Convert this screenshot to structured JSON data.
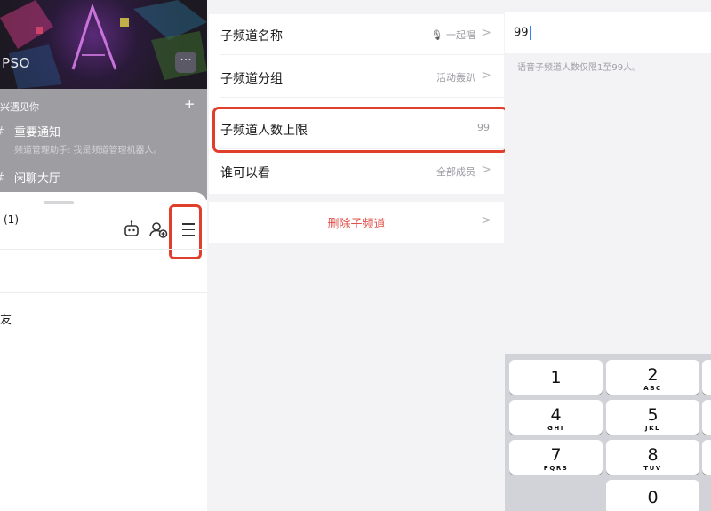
{
  "panel1": {
    "banner": {
      "brand_text": "PSO",
      "more_icon": "more-dots-icon"
    },
    "group": {
      "title": "兴遇见你",
      "add_icon": "+",
      "channels": [
        {
          "name": "重要通知",
          "sub": "频道管理助手: 我是频道管理机器人。",
          "icon": "announcement-icon"
        },
        {
          "name": "闲聊大厅",
          "sub": "",
          "icon": "chat-icon"
        }
      ]
    },
    "sheet": {
      "title": "(1)",
      "robot_icon": "robot-icon",
      "add_member_icon": "add-member-icon",
      "menu_icon": "menu-icon",
      "friend_text": "友"
    }
  },
  "panel2": {
    "rows": [
      {
        "label": "子频道名称",
        "value": "一起唱",
        "value_icon": "microphone-icon"
      },
      {
        "label": "子频道分组",
        "value": "活动轰趴"
      },
      {
        "label": "子频道人数上限",
        "value": "99"
      },
      {
        "label": "谁可以看",
        "value": "全部成员"
      }
    ],
    "delete_label": "删除子频道",
    "chevron": ">"
  },
  "panel3": {
    "input_value": "99",
    "hint": "语音子频道人数仅限1至99人。",
    "keys": [
      {
        "num": "1",
        "letters": ""
      },
      {
        "num": "2",
        "letters": "ABC"
      },
      {
        "num": "4",
        "letters": "GHI"
      },
      {
        "num": "5",
        "letters": "JKL"
      },
      {
        "num": "7",
        "letters": "PQRS"
      },
      {
        "num": "8",
        "letters": "TUV"
      },
      {
        "num": "0",
        "letters": ""
      }
    ]
  },
  "colors": {
    "highlight": "#e03f2b",
    "danger_text": "#e0524a",
    "caret": "#3a7bf7",
    "secondary_text": "#9b9ba2"
  }
}
